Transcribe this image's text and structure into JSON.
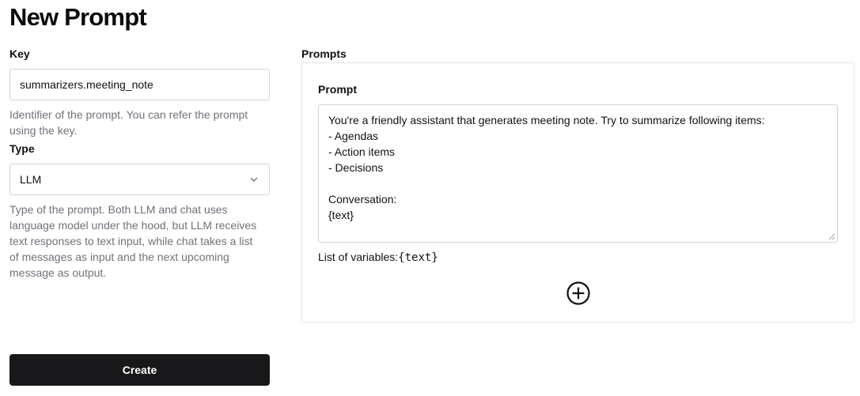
{
  "page": {
    "title": "New Prompt"
  },
  "key": {
    "label": "Key",
    "value": "summarizers.meeting_note",
    "help": "Identifier of the prompt. You can refer the prompt using the key."
  },
  "type": {
    "label": "Type",
    "selected": "LLM",
    "help": "Type of the prompt. Both LLM and chat uses language model under the hood, but LLM receives text responses to text input, while chat takes a list of messages as input and the next upcoming message as output."
  },
  "create_label": "Create",
  "prompts": {
    "label": "Prompts",
    "items": [
      {
        "label": "Prompt",
        "lines": [
          "You're a friendly assistant that generates meeting note. Try to summarize following items:",
          "- Agendas",
          "- Action items",
          "- Decisions",
          "",
          "Conversation:",
          "{text}"
        ],
        "variables_label": "List of variables:",
        "variables_value": "{text}"
      }
    ],
    "add_icon": "plus-circle-icon"
  },
  "colors": {
    "primary_button": "#18181b",
    "help_text": "#71717a",
    "border": "#d4d4d8"
  }
}
